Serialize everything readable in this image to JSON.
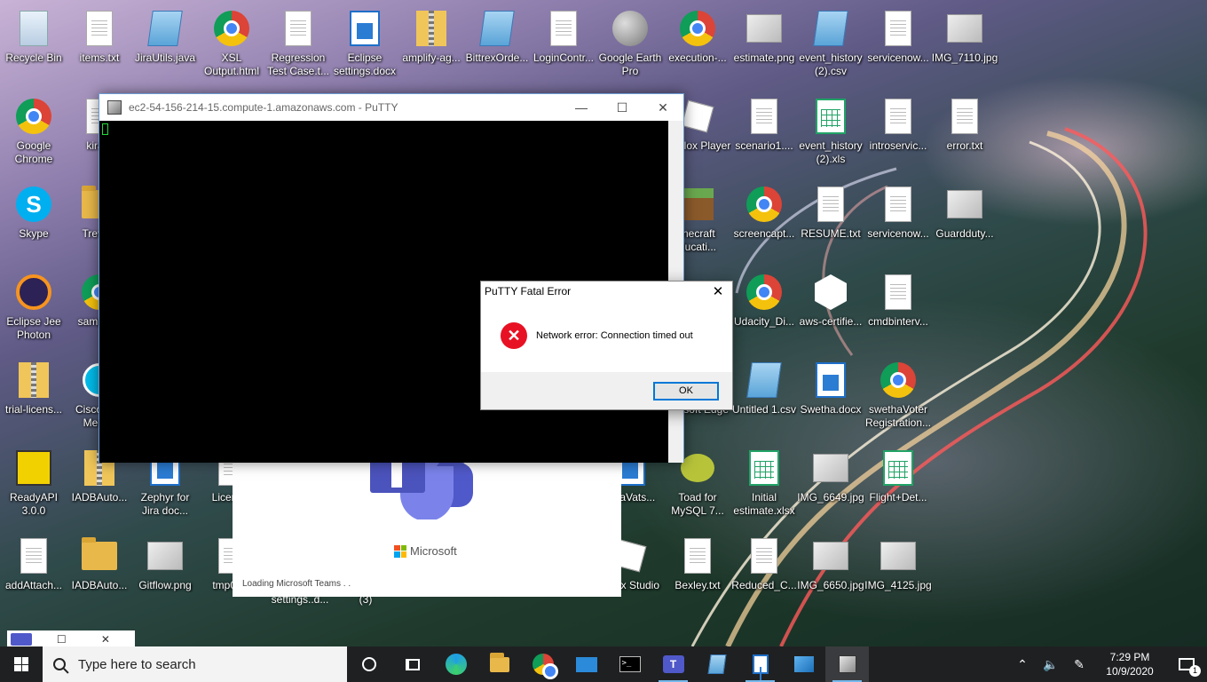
{
  "desktop": {
    "icons": [
      {
        "label": "Recycle Bin",
        "icon": "recycle-bin-icon"
      },
      {
        "label": "items.txt",
        "icon": "text-file-icon"
      },
      {
        "label": "JiraUtils.java",
        "icon": "notepad-file-icon"
      },
      {
        "label": "XSL Output.html",
        "icon": "chrome-icon"
      },
      {
        "label": "Regression Test Case.t...",
        "icon": "text-file-icon"
      },
      {
        "label": "Eclipse settings.docx",
        "icon": "docx-icon"
      },
      {
        "label": "amplify-ag...",
        "icon": "zip-folder-icon"
      },
      {
        "label": "BittrexOrde...",
        "icon": "notepad-file-icon"
      },
      {
        "label": "LoginContr...",
        "icon": "csharp-file-icon"
      },
      {
        "label": "Google Earth Pro",
        "icon": "google-earth-icon"
      },
      {
        "label": "execution-...",
        "icon": "chrome-icon"
      },
      {
        "label": "estimate.png",
        "icon": "image-file-icon"
      },
      {
        "label": "event_history (2).csv",
        "icon": "notepad-file-icon"
      },
      {
        "label": "servicenow...",
        "icon": "text-file-icon"
      },
      {
        "label": "IMG_7110.jpg",
        "icon": "image-file-icon"
      },
      {
        "label": "Google Chrome",
        "icon": "chrome-icon"
      },
      {
        "label": "kira...",
        "icon": "text-file-icon"
      },
      {
        "label": "Roblox Player",
        "icon": "roblox-icon"
      },
      {
        "label": "scenario1....",
        "icon": "text-file-icon"
      },
      {
        "label": "event_history (2).xls",
        "icon": "excel-icon"
      },
      {
        "label": "introservic...",
        "icon": "text-file-icon"
      },
      {
        "label": "error.txt",
        "icon": "text-file-icon"
      },
      {
        "label": "Skype",
        "icon": "skype-icon"
      },
      {
        "label": "Trevil...",
        "icon": "folder-icon"
      },
      {
        "label": "inecraft ducati...",
        "icon": "minecraft-icon"
      },
      {
        "label": "screencapt...",
        "icon": "chrome-icon"
      },
      {
        "label": "RESUME.txt",
        "icon": "text-file-icon"
      },
      {
        "label": "servicenow...",
        "icon": "text-file-icon"
      },
      {
        "label": "Guardduty...",
        "icon": "image-file-icon"
      },
      {
        "label": "Eclipse Jee Photon",
        "icon": "eclipse-icon"
      },
      {
        "label": "sample...",
        "icon": "chrome-icon"
      },
      {
        "label": "Udacity_Di...",
        "icon": "chrome-icon"
      },
      {
        "label": "aws-certifie...",
        "icon": "aws-badge-icon"
      },
      {
        "label": "cmdbinterv...",
        "icon": "text-file-icon"
      },
      {
        "label": "trial-licens...",
        "icon": "zip-folder-icon"
      },
      {
        "label": "Cisco W... Meet...",
        "icon": "webex-icon"
      },
      {
        "label": "icrosoft Edge",
        "icon": "edge-icon"
      },
      {
        "label": "Untitled 1.csv",
        "icon": "notepad-file-icon"
      },
      {
        "label": "Swetha.docx",
        "icon": "docx-icon"
      },
      {
        "label": "swethaVoter Registration...",
        "icon": "chrome-icon"
      },
      {
        "label": "ReadyAPI 3.0.0",
        "icon": "readyapi-icon"
      },
      {
        "label": "IADBAuto...",
        "icon": "zip-folder-icon"
      },
      {
        "label": "Zephyr for Jira doc...",
        "icon": "docx-icon"
      },
      {
        "label": "Licens...",
        "icon": "text-file-icon"
      },
      {
        "label": "ethaVats...",
        "icon": "docx-icon"
      },
      {
        "label": "Toad for MySQL 7...",
        "icon": "toad-icon"
      },
      {
        "label": "Initial estimate.xlsx",
        "icon": "excel-icon"
      },
      {
        "label": "IMG_6649.jpg",
        "icon": "image-file-icon"
      },
      {
        "label": "Flight+Det...",
        "icon": "excel-icon"
      },
      {
        "label": "addAttach...",
        "icon": "python-file-icon"
      },
      {
        "label": "IADBAuto...",
        "icon": "folder-icon"
      },
      {
        "label": "Gitflow.png",
        "icon": "image-file-icon"
      },
      {
        "label": "tmp00...",
        "icon": "text-file-icon"
      },
      {
        "label": "oblox Studio",
        "icon": "roblox-studio-icon"
      },
      {
        "label": "Bexley.txt",
        "icon": "text-file-icon"
      },
      {
        "label": "Reduced_C...",
        "icon": "text-file-icon"
      },
      {
        "label": "IMG_6650.jpg",
        "icon": "image-file-icon"
      },
      {
        "label": "IMG_4125.jpg",
        "icon": "image-file-icon"
      }
    ],
    "partial_labels": {
      "settings_d": "settings..d...",
      "three": "(3)"
    }
  },
  "putty": {
    "title": "ec2-54-156-214-15.compute-1.amazonaws.com - PuTTY",
    "minimize": "—",
    "maximize": "☐",
    "close": "✕"
  },
  "teams_splash": {
    "brand": "Microsoft",
    "loading": "Loading Microsoft Teams . ."
  },
  "error_dialog": {
    "title": "PuTTY Fatal Error",
    "message": "Network error: Connection timed out",
    "ok": "OK",
    "close": "✕"
  },
  "mini_window": {
    "buttons": "☐ ✕"
  },
  "taskbar": {
    "search_placeholder": "Type here to search",
    "apps": [
      "cortana",
      "task-view",
      "edge",
      "file-explorer",
      "chrome",
      "mail",
      "command-prompt",
      "teams",
      "notepad",
      "word",
      "photos",
      "putty"
    ],
    "active_app": "putty",
    "time": "7:29 PM",
    "date": "10/9/2020",
    "notification_count": "1"
  },
  "colors": {
    "accent": "#0078d7",
    "error_red": "#e81123",
    "terminal_bg": "#000000",
    "cursor": "#1fdc3a",
    "taskbar": "#1f2022"
  }
}
